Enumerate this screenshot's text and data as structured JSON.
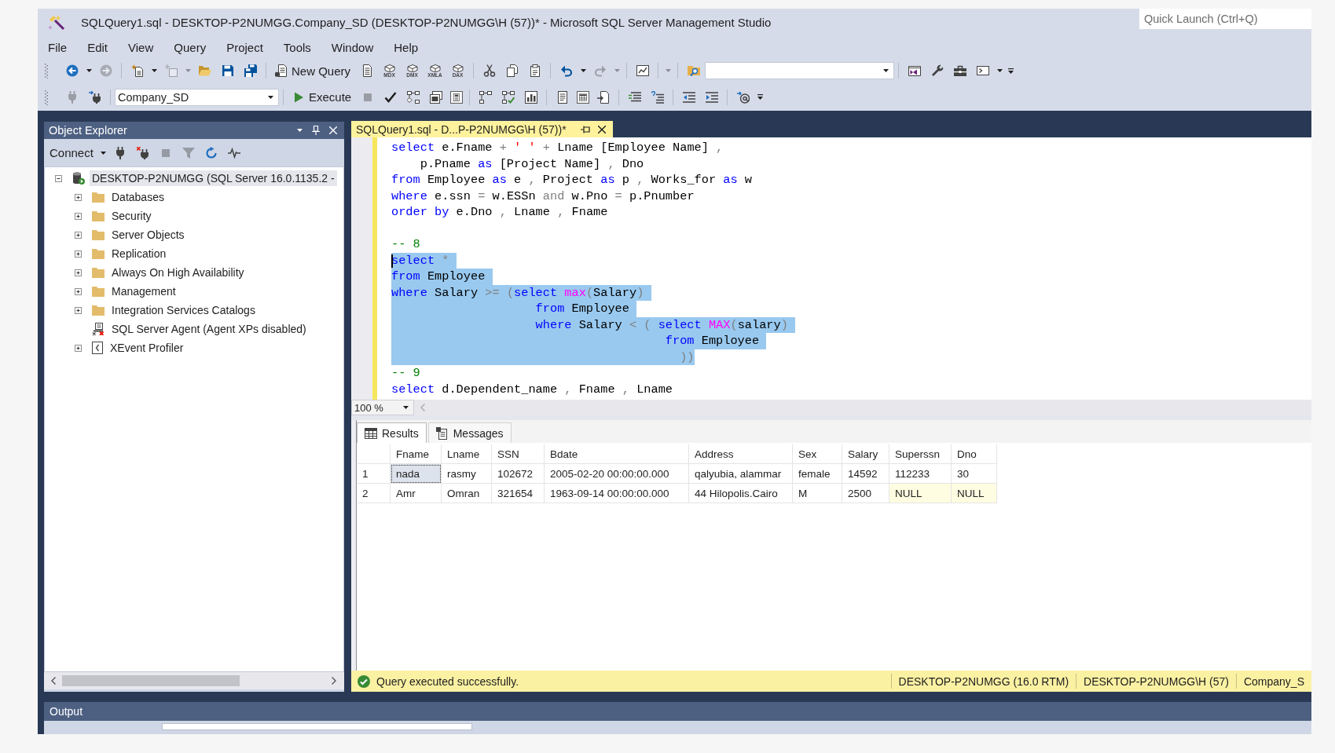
{
  "window": {
    "title": "SQLQuery1.sql - DESKTOP-P2NUMGG.Company_SD (DESKTOP-P2NUMGG\\H (57))* - Microsoft SQL Server Management Studio",
    "quick_launch": {
      "placeholder": "Quick Launch (Ctrl+Q)"
    }
  },
  "menu": [
    "File",
    "Edit",
    "View",
    "Query",
    "Project",
    "Tools",
    "Window",
    "Help"
  ],
  "toolbar": [
    {
      "kind": "back",
      "disabled": false
    },
    {
      "kind": "caret",
      "disabled": false
    },
    {
      "kind": "forward",
      "disabled": true
    },
    {
      "kind": "separator"
    },
    {
      "kind": "new_project",
      "disabled": false
    },
    {
      "kind": "caret",
      "disabled": false
    },
    {
      "kind": "add_item",
      "disabled": true
    },
    {
      "kind": "caret",
      "disabled": true
    },
    {
      "kind": "open",
      "disabled": false
    },
    {
      "kind": "save",
      "disabled": false
    },
    {
      "kind": "save_all",
      "disabled": false
    },
    {
      "kind": "separator"
    },
    {
      "kind": "new_query",
      "label": "New Query",
      "disabled": false
    },
    {
      "kind": "query_file",
      "disabled": false
    },
    {
      "kind": "cube",
      "label": "MDX",
      "disabled": false
    },
    {
      "kind": "cube",
      "label": "DMX",
      "disabled": false
    },
    {
      "kind": "cube",
      "label": "XMLA",
      "disabled": false
    },
    {
      "kind": "cube",
      "label": "DAX",
      "disabled": false
    },
    {
      "kind": "separator"
    },
    {
      "kind": "cut",
      "disabled": false
    },
    {
      "kind": "copy",
      "disabled": false
    },
    {
      "kind": "paste",
      "disabled": false
    },
    {
      "kind": "separator"
    },
    {
      "kind": "undo",
      "disabled": false
    },
    {
      "kind": "caret",
      "disabled": false
    },
    {
      "kind": "redo",
      "disabled": true
    },
    {
      "kind": "caret",
      "disabled": true
    },
    {
      "kind": "separator"
    },
    {
      "kind": "monitor",
      "disabled": false
    },
    {
      "kind": "separator"
    },
    {
      "kind": "caret",
      "disabled": true
    },
    {
      "kind": "separator"
    },
    {
      "kind": "find",
      "disabled": false
    },
    {
      "kind": "combo",
      "disabled": false
    },
    {
      "kind": "separator"
    },
    {
      "kind": "solution",
      "disabled": false
    },
    {
      "kind": "wrench",
      "disabled": false
    },
    {
      "kind": "toolbox",
      "disabled": false
    },
    {
      "kind": "terminal",
      "disabled": false
    },
    {
      "kind": "caret",
      "disabled": false
    },
    {
      "kind": "overflow",
      "disabled": false
    }
  ],
  "toolbar_2": [
    {
      "kind": "plug",
      "disabled": true,
      "pressed": false
    },
    {
      "kind": "change_connection",
      "disabled": false,
      "pressed": false
    },
    {
      "kind": "separator"
    },
    {
      "kind": "select",
      "value": "Company_SD",
      "disabled": false
    },
    {
      "kind": "separator"
    },
    {
      "kind": "execute",
      "label": "Execute",
      "disabled": false
    },
    {
      "kind": "stop",
      "disabled": true,
      "pressed": false
    },
    {
      "kind": "parse",
      "disabled": false,
      "pressed": false
    },
    {
      "kind": "est_plan",
      "disabled": false,
      "pressed": false
    },
    {
      "kind": "query_options",
      "disabled": false,
      "pressed": false
    },
    {
      "kind": "intellisense",
      "disabled": false,
      "pressed": true
    },
    {
      "kind": "separator"
    },
    {
      "kind": "actual_plan",
      "disabled": false,
      "pressed": false
    },
    {
      "kind": "live_stats",
      "disabled": false,
      "pressed": false
    },
    {
      "kind": "client_stats",
      "disabled": false,
      "pressed": false
    },
    {
      "kind": "separator"
    },
    {
      "kind": "results_text",
      "disabled": false,
      "pressed": false
    },
    {
      "kind": "results_grid",
      "disabled": false,
      "pressed": true
    },
    {
      "kind": "results_file",
      "disabled": false,
      "pressed": false
    },
    {
      "kind": "separator"
    },
    {
      "kind": "comment",
      "disabled": false,
      "pressed": false
    },
    {
      "kind": "uncomment",
      "disabled": false,
      "pressed": false
    },
    {
      "kind": "separator"
    },
    {
      "kind": "outdent",
      "disabled": false,
      "pressed": false
    },
    {
      "kind": "indent",
      "disabled": false,
      "pressed": false
    },
    {
      "kind": "separator"
    },
    {
      "kind": "template",
      "disabled": false,
      "pressed": false
    },
    {
      "kind": "overflow",
      "disabled": false
    }
  ],
  "object_explorer": {
    "title": "Object Explorer",
    "toolbar": [
      {
        "kind": "connect",
        "label": "Connect",
        "disabled": false
      },
      {
        "kind": "caret",
        "disabled": false
      },
      {
        "kind": "plug",
        "disabled": false
      },
      {
        "kind": "disconnect",
        "disabled": false
      },
      {
        "kind": "stop",
        "disabled": true
      },
      {
        "kind": "filter",
        "disabled": true
      },
      {
        "kind": "refresh",
        "disabled": false
      },
      {
        "kind": "activity",
        "disabled": false
      }
    ],
    "tree": [
      {
        "label": "DESKTOP-P2NUMGG (SQL Server 16.0.1135.2 -",
        "kind": "server",
        "expanded": true,
        "selected": true,
        "children": [
          {
            "label": "Databases",
            "kind": "folder",
            "expanded": false,
            "selected": false
          },
          {
            "label": "Security",
            "kind": "folder",
            "expanded": false,
            "selected": false
          },
          {
            "label": "Server Objects",
            "kind": "folder",
            "expanded": false,
            "selected": false
          },
          {
            "label": "Replication",
            "kind": "folder",
            "expanded": false,
            "selected": false
          },
          {
            "label": "Always On High Availability",
            "kind": "folder",
            "expanded": false,
            "selected": false
          },
          {
            "label": "Management",
            "kind": "folder",
            "expanded": false,
            "selected": false
          },
          {
            "label": "Integration Services Catalogs",
            "kind": "folder",
            "expanded": false,
            "selected": false
          },
          {
            "label": "SQL Server Agent (Agent XPs disabled)",
            "kind": "agent",
            "selected": false
          },
          {
            "label": "XEvent Profiler",
            "kind": "profiler",
            "expanded": false,
            "selected": false
          }
        ]
      }
    ]
  },
  "editor": {
    "tab": {
      "title": "SQLQuery1.sql - D...P-P2NUMGG\\H (57))*"
    },
    "lines": [
      {
        "tokens": [
          {
            "kind": "keyword",
            "text": "select"
          },
          {
            "kind": "plain",
            "text": " e.Fname "
          },
          {
            "kind": "operator",
            "text": "+ "
          },
          {
            "kind": "string",
            "text": "' ' "
          },
          {
            "kind": "operator",
            "text": "+"
          },
          {
            "kind": "plain",
            "text": " Lname [Employee Name] "
          },
          {
            "kind": "operator",
            "text": ","
          }
        ],
        "selected": false,
        "cursor": false
      },
      {
        "tokens": [
          {
            "kind": "plain",
            "text": "    p.Pname "
          },
          {
            "kind": "keyword",
            "text": "as"
          },
          {
            "kind": "plain",
            "text": " [Project Name] "
          },
          {
            "kind": "operator",
            "text": ","
          },
          {
            "kind": "plain",
            "text": " Dno"
          }
        ],
        "selected": false,
        "cursor": false
      },
      {
        "tokens": [
          {
            "kind": "keyword",
            "text": "from"
          },
          {
            "kind": "plain",
            "text": " Employee "
          },
          {
            "kind": "keyword",
            "text": "as"
          },
          {
            "kind": "plain",
            "text": " e "
          },
          {
            "kind": "operator",
            "text": ","
          },
          {
            "kind": "plain",
            "text": " Project "
          },
          {
            "kind": "keyword",
            "text": "as"
          },
          {
            "kind": "plain",
            "text": " p "
          },
          {
            "kind": "operator",
            "text": ","
          },
          {
            "kind": "plain",
            "text": " Works_for "
          },
          {
            "kind": "keyword",
            "text": "as"
          },
          {
            "kind": "plain",
            "text": " w"
          }
        ],
        "selected": false,
        "cursor": false
      },
      {
        "tokens": [
          {
            "kind": "keyword",
            "text": "where"
          },
          {
            "kind": "plain",
            "text": " e.ssn "
          },
          {
            "kind": "operator",
            "text": "="
          },
          {
            "kind": "plain",
            "text": " w.ESSn "
          },
          {
            "kind": "operator",
            "text": "and"
          },
          {
            "kind": "plain",
            "text": " w.Pno "
          },
          {
            "kind": "operator",
            "text": "="
          },
          {
            "kind": "plain",
            "text": " p.Pnumber"
          }
        ],
        "selected": false,
        "cursor": false
      },
      {
        "tokens": [
          {
            "kind": "keyword",
            "text": "order by"
          },
          {
            "kind": "plain",
            "text": " e.Dno "
          },
          {
            "kind": "operator",
            "text": ","
          },
          {
            "kind": "plain",
            "text": " Lname "
          },
          {
            "kind": "operator",
            "text": ","
          },
          {
            "kind": "plain",
            "text": " Fname"
          }
        ],
        "selected": false,
        "cursor": false
      },
      {
        "selected": false,
        "cursor": false
      },
      {
        "tokens": [
          {
            "kind": "comment",
            "text": "-- 8"
          }
        ],
        "selected": false,
        "cursor": false
      },
      {
        "tokens": [
          {
            "kind": "keyword",
            "text": "select "
          },
          {
            "kind": "operator",
            "text": "*"
          }
        ],
        "selected": true,
        "cursor": true
      },
      {
        "tokens": [
          {
            "kind": "keyword",
            "text": "from"
          },
          {
            "kind": "plain",
            "text": " Employee"
          }
        ],
        "selected": true,
        "cursor": false
      },
      {
        "tokens": [
          {
            "kind": "keyword",
            "text": "where"
          },
          {
            "kind": "plain",
            "text": " Salary "
          },
          {
            "kind": "operator",
            "text": ">= ("
          },
          {
            "kind": "keyword",
            "text": "select "
          },
          {
            "kind": "function",
            "text": "max"
          },
          {
            "kind": "operator",
            "text": "("
          },
          {
            "kind": "plain",
            "text": "Salary"
          },
          {
            "kind": "operator",
            "text": ")"
          }
        ],
        "selected": true,
        "cursor": false
      },
      {
        "tokens": [
          {
            "kind": "keyword",
            "text": "                    from"
          },
          {
            "kind": "plain",
            "text": " Employee"
          }
        ],
        "selected": true,
        "cursor": false
      },
      {
        "tokens": [
          {
            "kind": "keyword",
            "text": "                    where"
          },
          {
            "kind": "plain",
            "text": " Salary "
          },
          {
            "kind": "operator",
            "text": "< ( "
          },
          {
            "kind": "keyword",
            "text": "select "
          },
          {
            "kind": "function",
            "text": "MAX"
          },
          {
            "kind": "operator",
            "text": "("
          },
          {
            "kind": "plain",
            "text": "salary"
          },
          {
            "kind": "operator",
            "text": ")"
          }
        ],
        "selected": true,
        "cursor": false
      },
      {
        "tokens": [
          {
            "kind": "keyword",
            "text": "                                      from"
          },
          {
            "kind": "plain",
            "text": " Employee"
          }
        ],
        "selected": true,
        "cursor": false
      },
      {
        "tokens": [
          {
            "kind": "operator",
            "text": "                                        ))"
          }
        ],
        "selected": true,
        "cursor": false
      },
      {
        "tokens": [
          {
            "kind": "comment",
            "text": "-- 9"
          }
        ],
        "selected": false,
        "cursor": false
      },
      {
        "tokens": [
          {
            "kind": "keyword",
            "text": "select"
          },
          {
            "kind": "plain",
            "text": " d.Dependent_name "
          },
          {
            "kind": "operator",
            "text": ","
          },
          {
            "kind": "plain",
            "text": " Fname "
          },
          {
            "kind": "operator",
            "text": ","
          },
          {
            "kind": "plain",
            "text": " Lname"
          }
        ],
        "selected": false,
        "cursor": false
      }
    ],
    "zoom": "100 %"
  },
  "results": {
    "tabs": [
      {
        "label": "Results",
        "kind": "grid",
        "selected": true
      },
      {
        "label": "Messages",
        "kind": "messages",
        "selected": false
      }
    ],
    "table": {
      "columns": [
        "Fname",
        "Lname",
        "SSN",
        "Bdate",
        "Address",
        "Sex",
        "Salary",
        "Superssn",
        "Dno"
      ],
      "rows": [
        {
          "number": "1",
          "cells": [
            {
              "text": "nada",
              "null": false,
              "selected": true
            },
            {
              "text": "rasmy",
              "null": false,
              "selected": false
            },
            {
              "text": "102672",
              "null": false,
              "selected": false
            },
            {
              "text": "2005-02-20 00:00:00.000",
              "null": false,
              "selected": false
            },
            {
              "text": "qalyubia, alammar",
              "null": false,
              "selected": false
            },
            {
              "text": "female",
              "null": false,
              "selected": false
            },
            {
              "text": "14592",
              "null": false,
              "selected": false
            },
            {
              "text": "112233",
              "null": false,
              "selected": false
            },
            {
              "text": "30",
              "null": false,
              "selected": false
            }
          ]
        },
        {
          "number": "2",
          "cells": [
            {
              "text": "Amr",
              "null": false,
              "selected": false
            },
            {
              "text": "Omran",
              "null": false,
              "selected": false
            },
            {
              "text": "321654",
              "null": false,
              "selected": false
            },
            {
              "text": "1963-09-14 00:00:00.000",
              "null": false,
              "selected": false
            },
            {
              "text": "44 Hilopolis.Cairo",
              "null": false,
              "selected": false
            },
            {
              "text": "M",
              "null": false,
              "selected": false
            },
            {
              "text": "2500",
              "null": false,
              "selected": false
            },
            {
              "text": "NULL",
              "null": true,
              "selected": false
            },
            {
              "text": "NULL",
              "null": true,
              "selected": false
            }
          ]
        }
      ]
    }
  },
  "status_bar": {
    "message": "Query executed successfully.",
    "segments": [
      "DESKTOP-P2NUMGG (16.0 RTM)",
      "DESKTOP-P2NUMGG\\H (57)",
      "Company_S"
    ]
  },
  "output": {
    "title": "Output"
  }
}
